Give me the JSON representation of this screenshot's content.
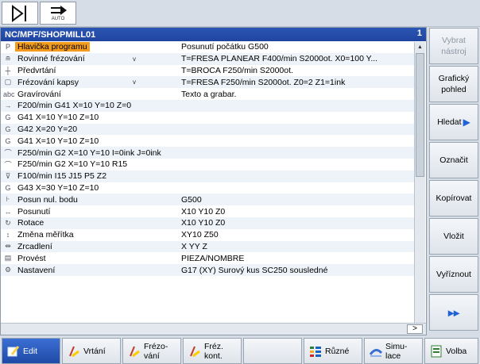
{
  "topbar": {
    "auto_label": "AUTO"
  },
  "editor": {
    "title": "NC/MPF/SHOPMILL01",
    "channel": "1",
    "more_indicator": ">"
  },
  "program_rows": [
    {
      "icon": "P",
      "name": "Hlavička programu",
      "value": "Posunutí počátku G500",
      "highlight": true
    },
    {
      "icon": "≘",
      "name": "Rovinné frézování",
      "caret": "v",
      "value": "T=FRESA PLANEAR F400/min S2000ot. X0=100 Y..."
    },
    {
      "icon": "┼",
      "name": "Předvrtání",
      "value": "T=BROCA F250/min S2000ot."
    },
    {
      "icon": "▢",
      "name": "Frézování kapsy",
      "caret": "v",
      "value": "T=FRESA F250/min S2000ot. Z0=2 Z1=1ink"
    },
    {
      "icon": "abc",
      "name": "Gravírování",
      "value": "Texto a grabar."
    },
    {
      "icon": "→",
      "full": "F200/min G41 X=10 Y=10 Z=0"
    },
    {
      "icon": "G",
      "full": "G41 X=10 Y=10 Z=10"
    },
    {
      "icon": "G",
      "full": "G42 X=20 Y=20"
    },
    {
      "icon": "G",
      "full": "G41 X=10 Y=10 Z=10"
    },
    {
      "icon": "⌒",
      "full": "F250/min G2 X=10 Y=10 I=0ink J=0ink"
    },
    {
      "icon": "⌒",
      "full": "F250/min G2 X=10 Y=10 R15"
    },
    {
      "icon": "⊽",
      "full": "F100/min I15 J15 P5 Z2"
    },
    {
      "icon": "G",
      "full": "G43 X=30 Y=10 Z=10"
    },
    {
      "icon": "⊦",
      "name": "Posun nul. bodu",
      "value": "G500"
    },
    {
      "icon": "↔",
      "name": "Posunutí",
      "value": "X10 Y10 Z0"
    },
    {
      "icon": "↻",
      "name": "Rotace",
      "value": "X10 Y10 Z0"
    },
    {
      "icon": "↕",
      "name": "Změna měřítka",
      "value": "XY10 Z50"
    },
    {
      "icon": "⇹",
      "name": "Zrcadlení",
      "value": "X YY Z"
    },
    {
      "icon": "▤",
      "name": "Provést",
      "value": "PIEZA/NOMBRE"
    },
    {
      "icon": "⚙",
      "name": "Nastavení",
      "value": "G17 (XY) Surový kus SC250 sousledné"
    }
  ],
  "right_softkeys": [
    {
      "label1": "Vybrat",
      "label2": "nástroj",
      "disabled": true
    },
    {
      "label1": "Grafický",
      "label2": "pohled"
    },
    {
      "label1": "Hledat",
      "label2": ""
    },
    {
      "label1": "Označit",
      "label2": ""
    },
    {
      "label1": "Kopírovat",
      "label2": ""
    },
    {
      "label1": "Vložit",
      "label2": ""
    },
    {
      "label1": "Vyříznout",
      "label2": ""
    },
    {
      "label1": "▸▸",
      "label2": ""
    }
  ],
  "bottom_softkeys": [
    {
      "label1": "Edit",
      "label2": "",
      "icon": "edit-icon",
      "active": true
    },
    {
      "label1": "Vrtání",
      "label2": "",
      "icon": "drilling-icon"
    },
    {
      "label1": "Frézo-",
      "label2": "vání",
      "icon": "milling-icon"
    },
    {
      "label1": "Fréz.",
      "label2": "kont.",
      "icon": "contour-milling-icon"
    },
    {
      "label1": "",
      "label2": "",
      "icon": ""
    },
    {
      "label1": "Různé",
      "label2": "",
      "icon": "various-icon"
    },
    {
      "label1": "Simu-",
      "label2": "lace",
      "icon": "simulation-icon"
    },
    {
      "label1": "Volba",
      "label2": "",
      "icon": "select-icon"
    }
  ],
  "colors": {
    "title_bar": "#2b56b3",
    "highlight": "#f29b1d",
    "accent": "#1e62d6"
  }
}
